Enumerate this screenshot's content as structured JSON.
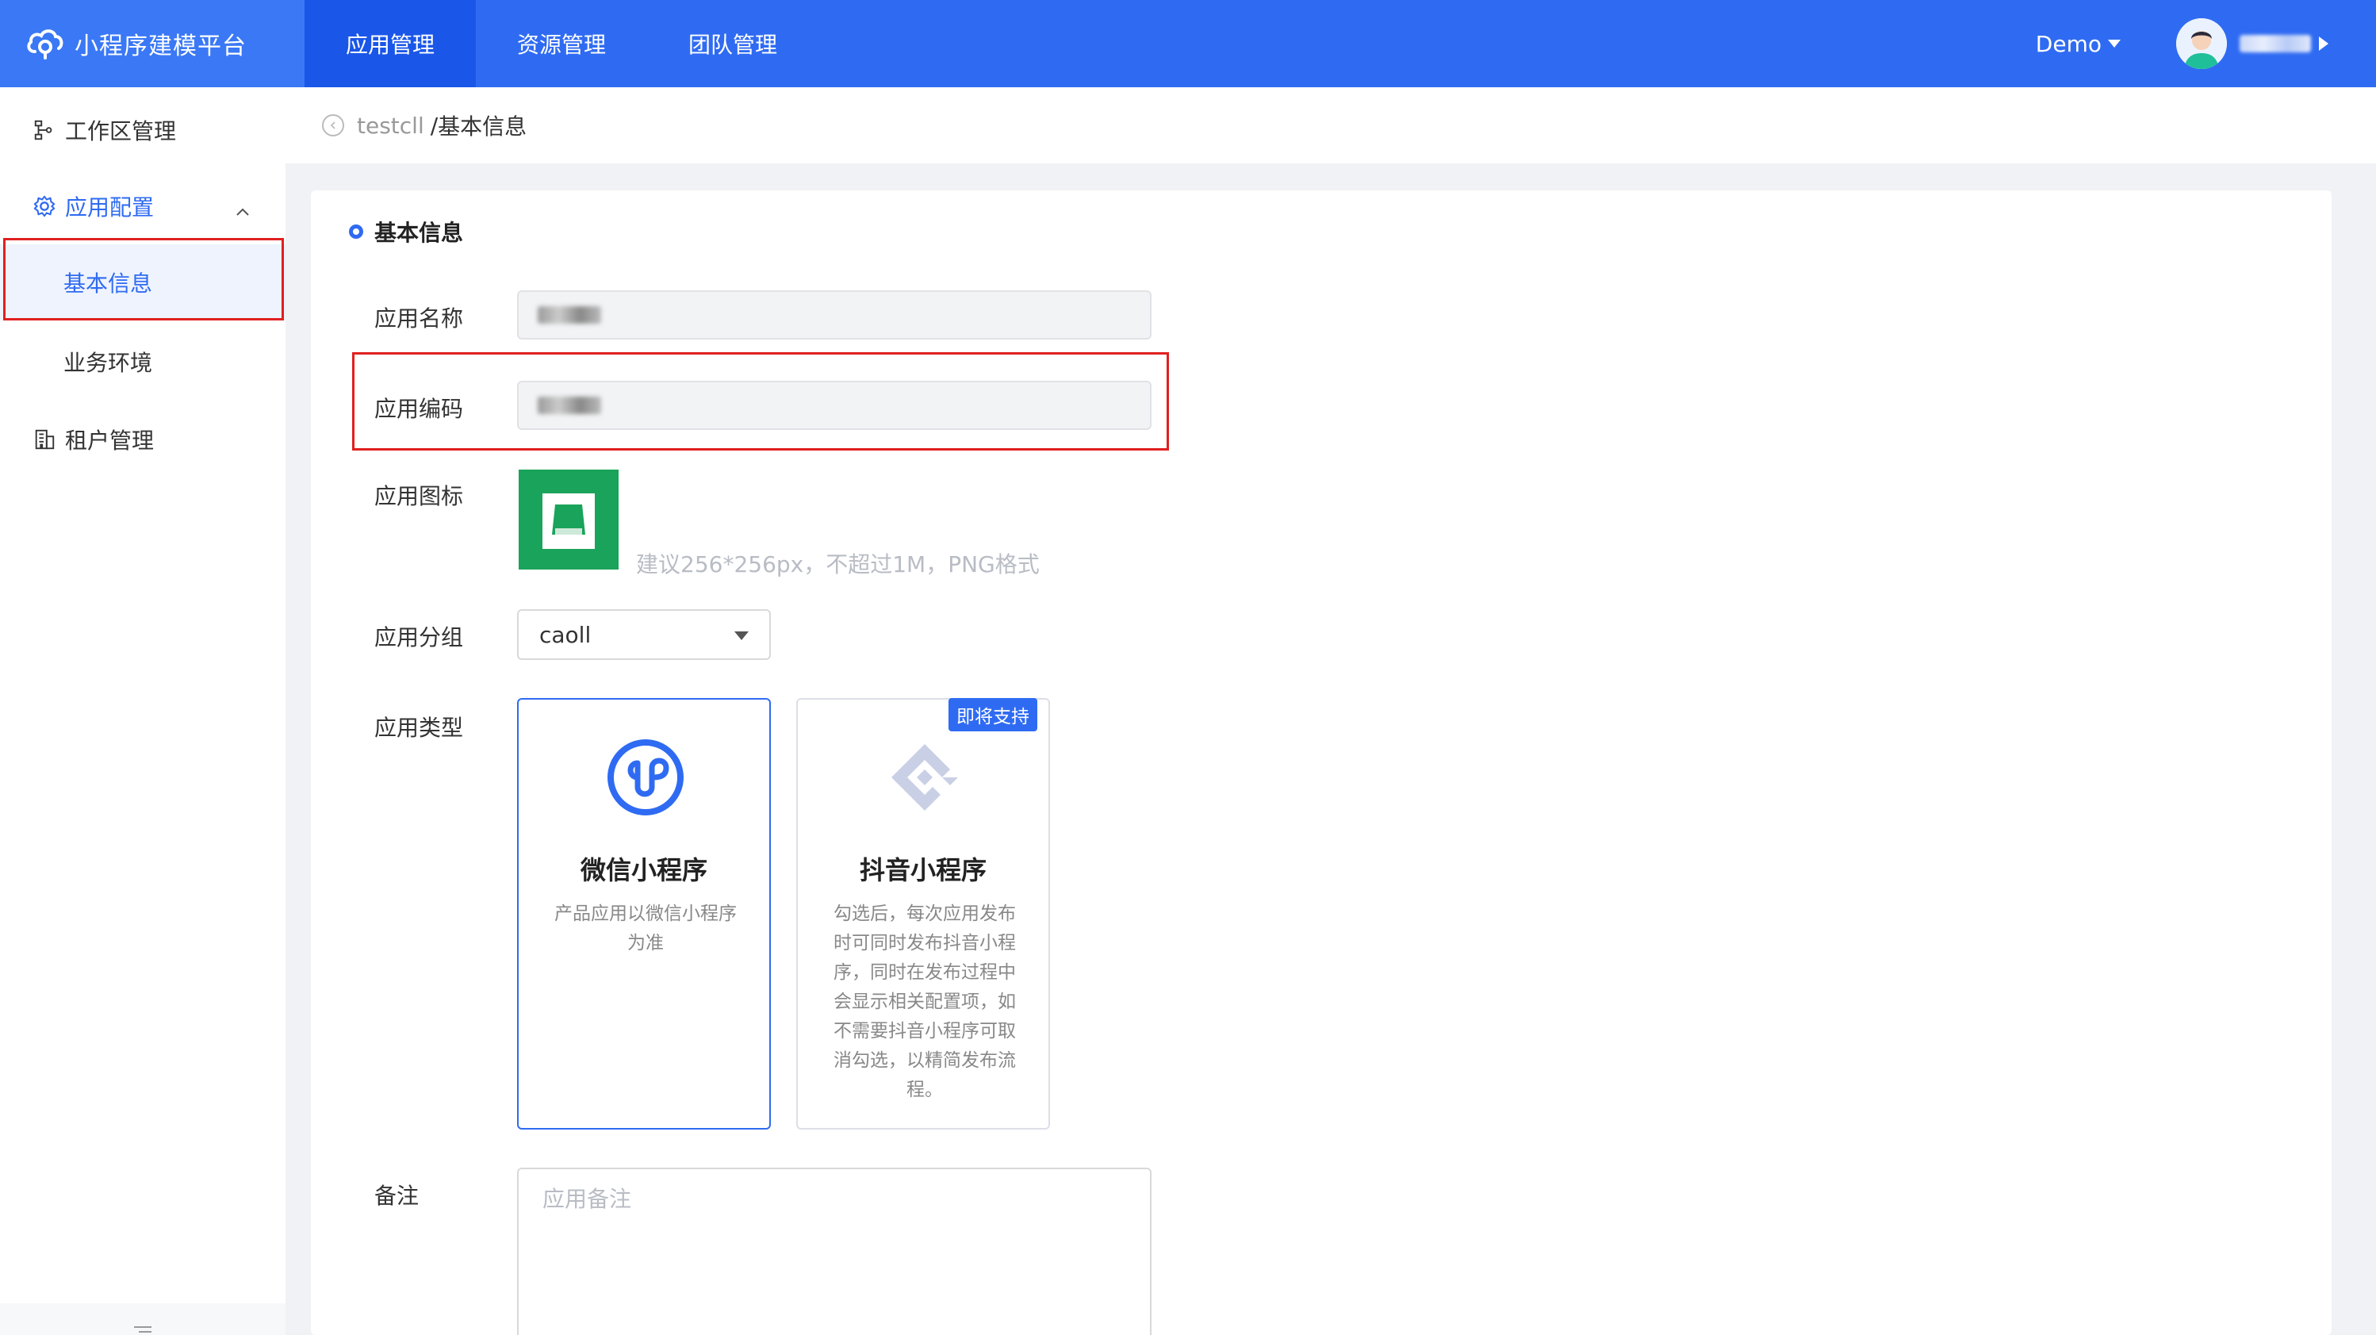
{
  "app": {
    "title": "小程序建模平台"
  },
  "topnav": {
    "items": [
      {
        "label": "应用管理",
        "active": true
      },
      {
        "label": "资源管理",
        "active": false
      },
      {
        "label": "团队管理",
        "active": false
      }
    ],
    "demo_label": "Demo"
  },
  "sidebar": {
    "items": [
      {
        "label": "工作区管理",
        "icon": "workspace-icon"
      },
      {
        "label": "应用配置",
        "icon": "gear-icon",
        "expanded": true
      },
      {
        "label": "基本信息",
        "active": true
      },
      {
        "label": "业务环境"
      },
      {
        "label": "租户管理",
        "icon": "building-icon"
      }
    ]
  },
  "breadcrumb": {
    "parent": "testcll",
    "separator": "/",
    "current": "基本信息"
  },
  "form": {
    "section_title": "基本信息",
    "labels": {
      "name": "应用名称",
      "code": "应用编码",
      "icon": "应用图标",
      "group": "应用分组",
      "type": "应用类型",
      "remark": "备注"
    },
    "icon_hint": "建议256*256px，不超过1M，PNG格式",
    "group_value": "caoll",
    "types": [
      {
        "title": "微信小程序",
        "desc": "产品应用以微信小程序为准",
        "selected": true
      },
      {
        "title": "抖音小程序",
        "desc": "勾选后，每次应用发布时可同时发布抖音小程序，同时在发布过程中会显示相关配置项，如不需要抖音小程序可取消勾选，以精简发布流程。",
        "badge": "即将支持",
        "selected": false
      }
    ],
    "remark_placeholder": "应用备注"
  },
  "colors": {
    "primary": "#2f6bf2",
    "highlight": "#e02020",
    "icon_green": "#1aa35a"
  }
}
